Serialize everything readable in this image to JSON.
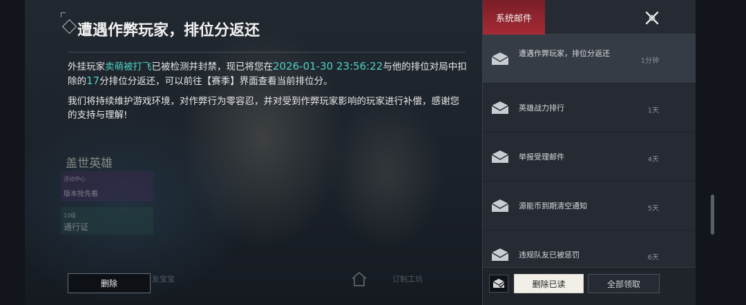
{
  "mail": {
    "title": "遭遇作弊玩家，排位分返还",
    "p1_a": "外挂玩家",
    "p1_player": "卖萌被打飞",
    "p1_b": "已被检测并封禁，现已将您在",
    "p1_time": "2026-01-30 23:56:22",
    "p1_c": "与他的排位对局中扣除的",
    "p1_points": "17",
    "p1_d": "分排位分返还，可以前往【赛季】界面查看当前排位分。",
    "p2": "我们将持续维护游戏环境，对作弊行为零容忍，并对受到作弊玩家影响的玩家进行补偿，感谢您的支持与理解!",
    "delete_label": "删除"
  },
  "panel": {
    "tab_label": "系统邮件",
    "items": [
      {
        "title": "遭遇作弊玩家，排位分返还",
        "time": "1分钟"
      },
      {
        "title": "英雄战力排行",
        "time": "1天"
      },
      {
        "title": "举报受理邮件",
        "time": "4天"
      },
      {
        "title": "源能币到期清空通知",
        "time": "5天"
      },
      {
        "title": "违规队友已被惩罚",
        "time": "6天"
      }
    ],
    "delete_read_label": "删除已读",
    "claim_all_label": "全部领取"
  },
  "background": {
    "ghost_title": "盖世英雄",
    "ghost_sub1": "活动中心",
    "ghost_sub2": "版本抢先看",
    "ghost_sub3": "10级",
    "ghost_sub4": "通行证",
    "ghost_bottom1": "友宝宝",
    "ghost_bottom2": "订制工坊"
  },
  "colors": {
    "accent_teal": "#4ed0c4",
    "tab_red": "#a52a33"
  }
}
